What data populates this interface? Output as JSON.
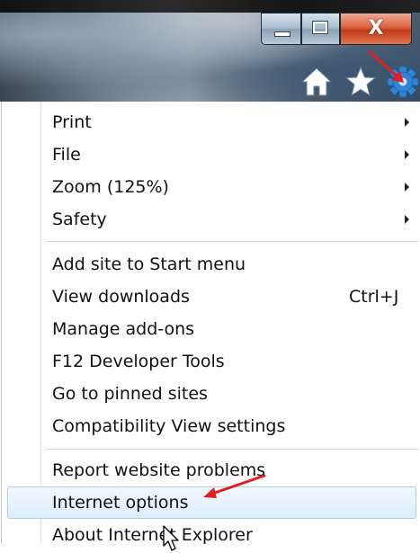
{
  "window": {
    "buttons": {
      "minimize": "minimize",
      "maximize": "maximize",
      "close": "X"
    }
  },
  "toolbar": {
    "icons": [
      "home-icon",
      "star-icon",
      "gear-icon"
    ]
  },
  "colors": {
    "annotation_arrow": "#e02020",
    "highlight_border": "#a9d0ef",
    "highlight_fill": "#dcedfc",
    "close_button": "#c1391a"
  },
  "menu": {
    "group1": [
      {
        "label": "Print",
        "submenu": true
      },
      {
        "label": "File",
        "submenu": true
      },
      {
        "label": "Zoom (125%)",
        "submenu": true
      },
      {
        "label": "Safety",
        "submenu": true
      }
    ],
    "group2": [
      {
        "label": "Add site to Start menu"
      },
      {
        "label": "View downloads",
        "shortcut": "Ctrl+J"
      },
      {
        "label": "Manage add-ons"
      },
      {
        "label": "F12 Developer Tools"
      },
      {
        "label": "Go to pinned sites"
      },
      {
        "label": "Compatibility View settings"
      }
    ],
    "group3": [
      {
        "label": "Report website problems"
      },
      {
        "label": "Internet options",
        "highlighted": true
      },
      {
        "label": "About Internet Explorer"
      }
    ]
  }
}
